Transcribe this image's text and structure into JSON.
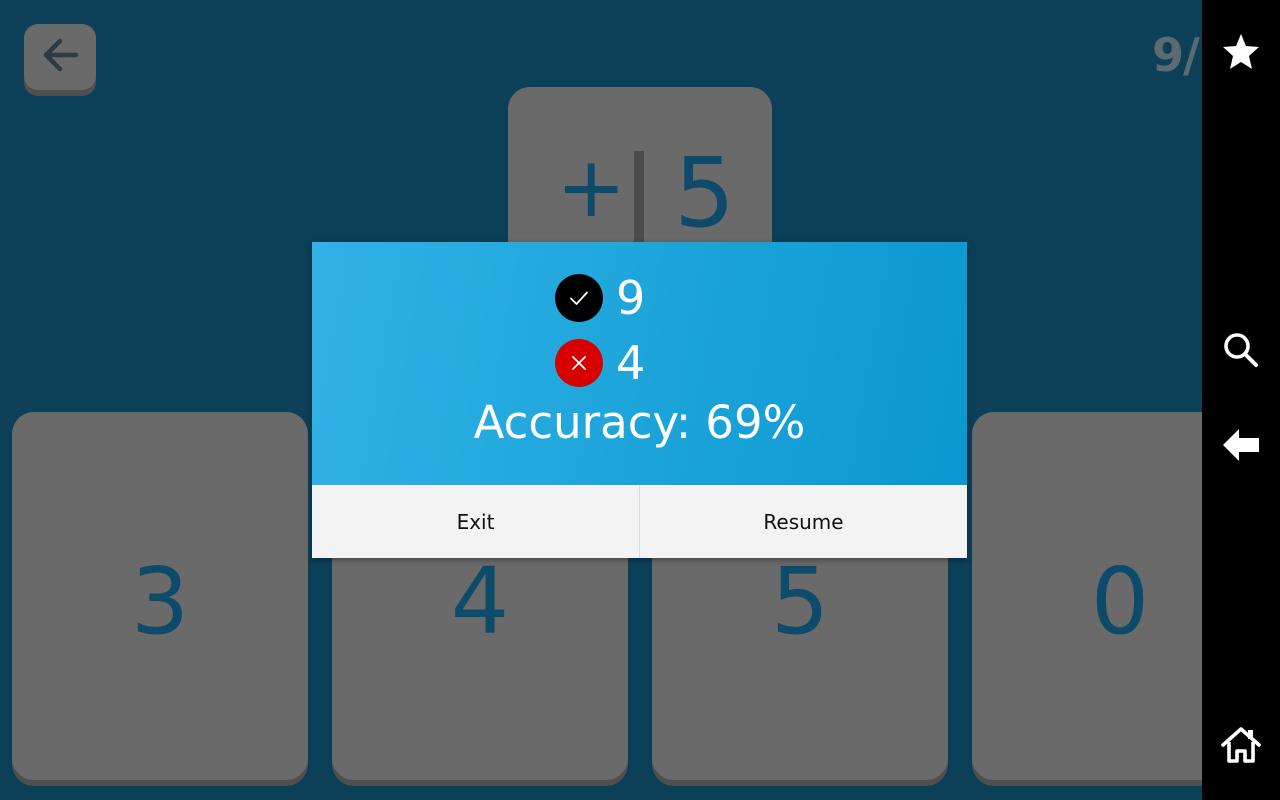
{
  "game": {
    "score_partial": "9/",
    "question": {
      "operator": "+",
      "number": "5"
    },
    "answers": [
      "3",
      "4",
      "5",
      "0"
    ]
  },
  "dialog": {
    "correct_count": "9",
    "wrong_count": "4",
    "accuracy_text": "Accuracy: 69%",
    "exit_label": "Exit",
    "resume_label": "Resume"
  },
  "icons": {
    "back": "arrow-left-icon",
    "correct": "check-icon",
    "wrong": "close-icon",
    "nav": [
      "star-icon",
      "search-icon",
      "back-arrow-icon",
      "home-icon"
    ]
  },
  "colors": {
    "background": "#0c3f58",
    "card": "#6a6a6a",
    "card_text": "#0e4a69",
    "dialog_gradient_start": "#31b2e6",
    "dialog_gradient_end": "#0a98cf",
    "correct_icon_bg": "#000000",
    "wrong_icon_bg": "#d60000",
    "button_bar": "#f3f3f3",
    "navbar": "#000000"
  }
}
